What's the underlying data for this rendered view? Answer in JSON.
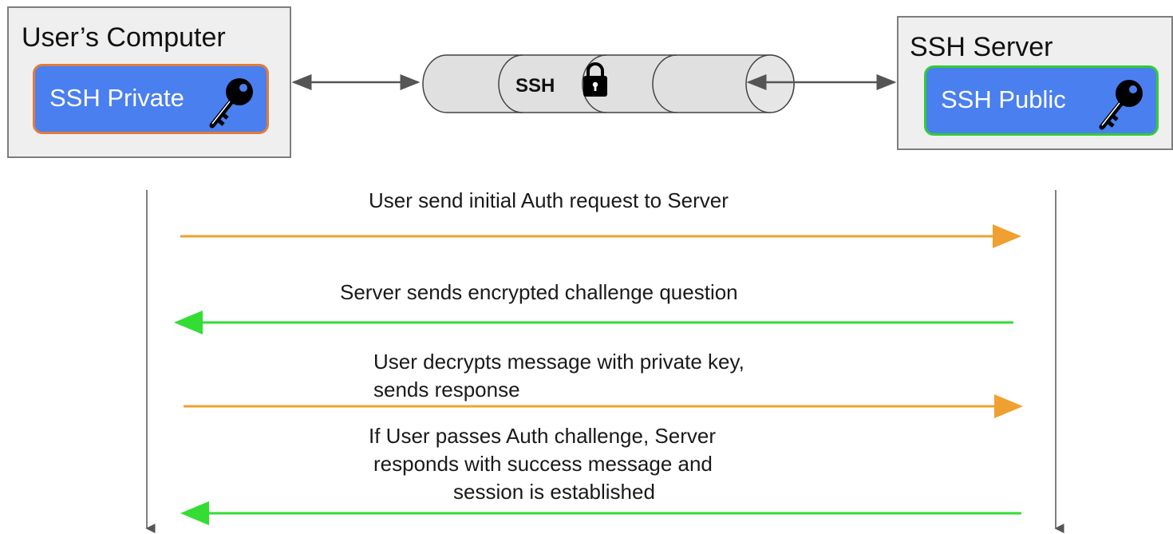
{
  "user_computer": {
    "title": "User’s Computer",
    "key_label": "SSH Private",
    "key_icon": "key-icon",
    "border_color": "#e07b3a"
  },
  "ssh_server": {
    "title": "SSH Server",
    "key_label": "SSH Public",
    "key_icon": "key-icon",
    "border_color": "#33cc33"
  },
  "tunnel": {
    "label": "SSH",
    "icon": "lock-icon"
  },
  "colors": {
    "key_card_fill": "#4a7ff0",
    "user_to_server_arrow": "#f0a030",
    "server_to_user_arrow": "#33dd33"
  },
  "messages": [
    {
      "lines": [
        "User send initial Auth request to Server"
      ],
      "direction": "to-server"
    },
    {
      "lines": [
        "Server sends encrypted challenge question"
      ],
      "direction": "to-user"
    },
    {
      "lines": [
        "User decrypts message with private key,",
        "sends response"
      ],
      "direction": "to-server"
    },
    {
      "lines": [
        "If User passes Auth challenge, Server",
        "responds with success message and",
        "session is established"
      ],
      "direction": "to-user"
    }
  ]
}
